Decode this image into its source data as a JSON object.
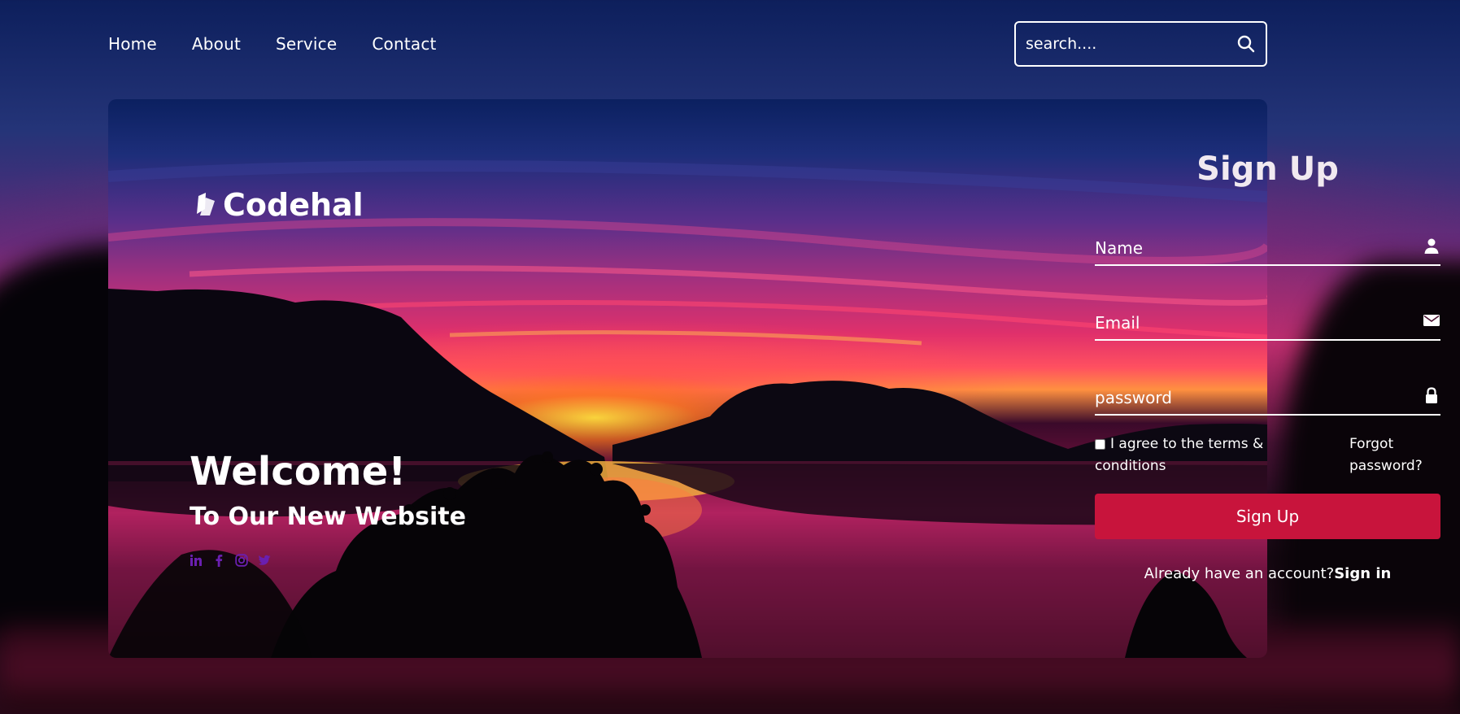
{
  "nav": {
    "links": [
      "Home",
      "About",
      "Service",
      "Contact"
    ],
    "search_placeholder": "search...."
  },
  "brand": {
    "name": "Codehal"
  },
  "hero": {
    "title": "Welcome!",
    "subtitle": "To Our New Website",
    "socials": [
      "linkedin-icon",
      "facebook-icon",
      "instagram-icon",
      "twitter-icon"
    ]
  },
  "signup": {
    "title": "Sign Up",
    "name_placeholder": "Name",
    "email_placeholder": "Email",
    "password_placeholder": "password",
    "agree_label": "I agree to the terms & conditions",
    "forgot_label": "Forgot password?",
    "button_label": "Sign Up",
    "have_account": "Already have an account?",
    "sign_in_link": "Sign in"
  },
  "colors": {
    "accent": "#c8143c",
    "text": "#ffffff",
    "social_icons": "#6a1fb0"
  }
}
